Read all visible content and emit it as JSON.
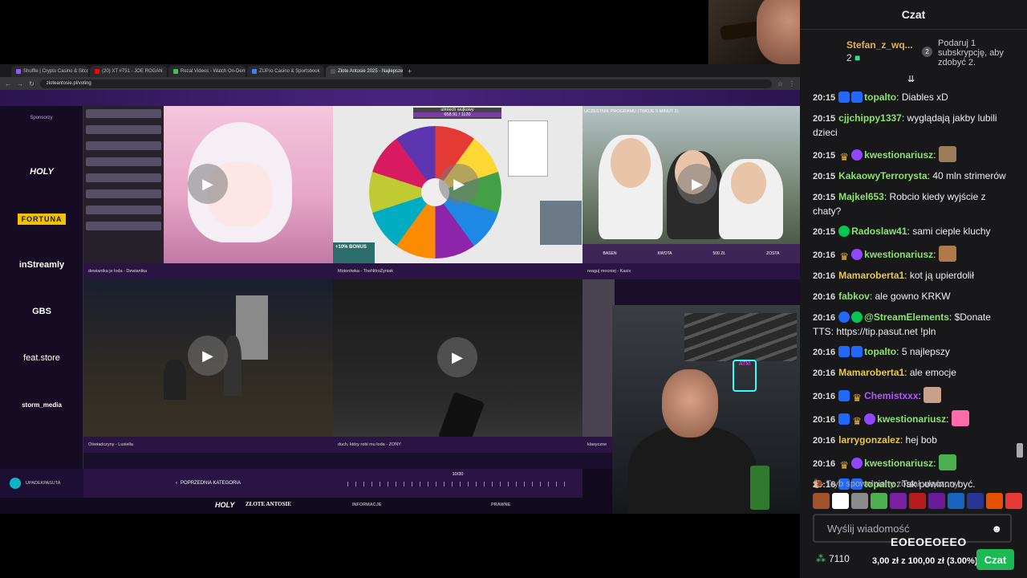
{
  "browser": {
    "tabs": [
      {
        "label": "Shuffle | Crypto Casino & Sitcoin",
        "color": "#8f5bff"
      },
      {
        "label": "(20) XT #751 - JOE ROGAN",
        "color": "#ff0000"
      },
      {
        "label": "Rezal Videos - Watch On-Demand",
        "color": "#40c057"
      },
      {
        "label": "ZUP.io Casino & Sportsbook",
        "color": "#3b82f6"
      },
      {
        "label": "Złote Antosie 2025 - Najlepsze",
        "color": "#555555"
      }
    ],
    "new_tab": "+",
    "url": "zloteantosie.pl/voting"
  },
  "site": {
    "sponsors_heading": "Sponsorzy",
    "sponsors": [
      "HOLY",
      "FORTUNA",
      "inStreamly",
      "GBS",
      "feat.store",
      "storm_media"
    ],
    "wheel_title": "ulmiech wujkowy",
    "wheel_sub": "658.91 / 1120",
    "bonus_label": "+10% BONUS",
    "race_banner": "UCZESTNIK PROGRAMU (TWOJE 5 MINUT 2)",
    "race_labels": [
      "BASEN",
      "KWOTA",
      "500 ZŁ",
      "ZOSTA"
    ],
    "cards": [
      {
        "caption": "dewiantka je loda - Dewiantka"
      },
      {
        "caption": "Motorówka - TheNitroŻyniak"
      },
      {
        "caption": "reaguj mocniej - Kasix"
      },
      {
        "caption": "Oświadczyny - Lusiella"
      },
      {
        "caption": "duch, który robi mu loda - ZONY"
      },
      {
        "caption": "klasyczne"
      }
    ],
    "footer": {
      "user": "UPADEKPASUTA",
      "prev_category": "POPRZEDNIA KATEGORIA",
      "counter": "10/30",
      "logo_holy": "HOLY",
      "logo_zlote": "ZŁOTE ANTOSIE",
      "info": "INFORMACJE",
      "legal": "PRAWNE"
    }
  },
  "chat": {
    "title": "Czat",
    "sub_user": "Stefan_z_wq...",
    "sub_count": "2",
    "sub_cta": "Podaruj 1 subskrypcję, aby zdobyć 2.",
    "sub_cta_badge": "2",
    "messages": [
      {
        "time": "20:15",
        "user": "topalto",
        "color": "#8be36c",
        "text": "Diables xD",
        "badges": [
          "b-blue",
          "b-blue"
        ]
      },
      {
        "time": "20:15",
        "user": "cjjchippy1337",
        "color": "#8be36c",
        "text": "wyglądają jakby lubili dzieci",
        "badges": []
      },
      {
        "time": "20:15",
        "user": "kwestionariusz",
        "color": "#8be36c",
        "text": "",
        "badges": [
          "b-crown",
          "b-purple"
        ],
        "emote": "#9c7b5a"
      },
      {
        "time": "20:15",
        "user": "KakaowyTerrorysta",
        "color": "#8be36c",
        "text": "40 mln strimerów",
        "badges": []
      },
      {
        "time": "20:15",
        "user": "Majkel653",
        "color": "#8be36c",
        "text": "Robcio kiedy wyjście z chaty?",
        "badges": []
      },
      {
        "time": "20:15",
        "user": "Radoslaw41",
        "color": "#8be36c",
        "text": "sami cieple kluchy",
        "badges": [
          "b-green"
        ]
      },
      {
        "time": "20:16",
        "user": "kwestionariusz",
        "color": "#8be36c",
        "text": "",
        "badges": [
          "b-crown",
          "b-purple"
        ],
        "emote": "#b07a48"
      },
      {
        "time": "20:16",
        "user": "Mamaroberta1",
        "color": "#e8c84a",
        "text": "kot ją upierdolił",
        "badges": []
      },
      {
        "time": "20:16",
        "user": "fabkov",
        "color": "#8be36c",
        "text": "ale gowno KRKW",
        "badges": []
      },
      {
        "time": "20:16",
        "user": "@StreamElements",
        "color": "#8be36c",
        "text": "$Donate TTS: https://tip.pasut.net !pln",
        "badges": [
          "b-bot",
          "b-green"
        ]
      },
      {
        "time": "20:16",
        "user": "topalto",
        "color": "#8be36c",
        "text": "5 najlepszy",
        "badges": [
          "b-blue",
          "b-blue"
        ]
      },
      {
        "time": "20:16",
        "user": "Mamaroberta1",
        "color": "#e8c84a",
        "text": "ale emocje",
        "badges": []
      },
      {
        "time": "20:16",
        "user": "Chemistxxx",
        "color": "#b455ff",
        "text": "",
        "badges": [
          "b-blue",
          "b-crown"
        ],
        "emote": "#c9a08a"
      },
      {
        "time": "20:16",
        "user": "kwestionariusz",
        "color": "#8be36c",
        "text": "",
        "badges": [
          "b-blue",
          "b-crown",
          "b-purple"
        ],
        "emote": "#ff6aa8"
      },
      {
        "time": "20:16",
        "user": "larrygonzalez",
        "color": "#e8c84a",
        "text": "hej bob",
        "badges": []
      },
      {
        "time": "20:16",
        "user": "kwestionariusz",
        "color": "#8be36c",
        "text": "",
        "badges": [
          "b-crown",
          "b-purple"
        ],
        "emote": "#4caf50"
      },
      {
        "time": "20:16",
        "user": "topalto",
        "color": "#8be36c",
        "text": "Tak powinno być.",
        "badges": [
          "b-blue",
          "b-blue"
        ]
      }
    ],
    "slow_mode": "Tryb spowolniony został włączony",
    "emote_colors": [
      "#a0522d",
      "#ffffff",
      "#8a8a8a",
      "#4caf50",
      "#7b1fa2",
      "#b71c1c",
      "#6a1b9a",
      "#1565c0",
      "#283593",
      "#e65100",
      "#e53935"
    ],
    "input_placeholder": "Wyślij wiadomość",
    "overlay_text": "EOEOEOEEO",
    "points": "7110",
    "goal": "3,00 zł z 100,00 zł (3.00%)",
    "send_button": "Czat"
  }
}
